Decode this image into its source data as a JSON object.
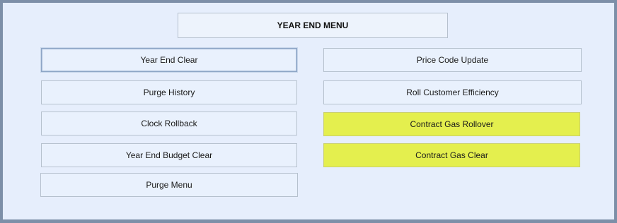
{
  "menu": {
    "title": "YEAR END MENU"
  },
  "left_buttons": [
    {
      "label": "Year End Clear"
    },
    {
      "label": "Purge History"
    },
    {
      "label": "Clock Rollback"
    },
    {
      "label": "Year End Budget Clear"
    },
    {
      "label": "Purge Menu"
    }
  ],
  "right_buttons": [
    {
      "label": "Price Code Update"
    },
    {
      "label": "Roll Customer Efficiency"
    },
    {
      "label": "Contract Gas Rollover"
    },
    {
      "label": "Contract Gas Clear"
    }
  ],
  "colors": {
    "highlight": "#e4ef4e",
    "panel_background": "#e6eefc",
    "frame": "#7d8fa8"
  }
}
